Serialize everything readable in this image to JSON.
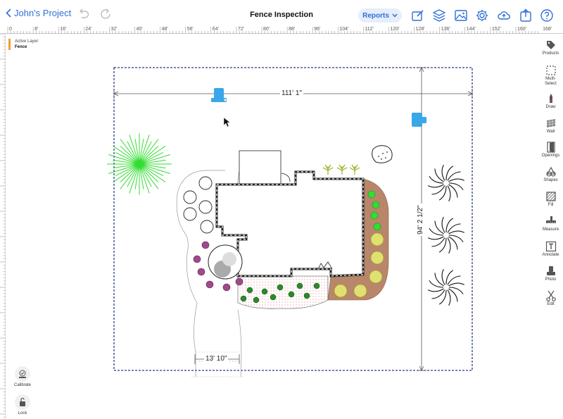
{
  "header": {
    "back_label": "John's Project",
    "title": "Fence Inspection",
    "reports_label": "Reports"
  },
  "ruler": {
    "labels": [
      "0",
      "8'",
      "16'",
      "24'",
      "32'",
      "40'",
      "48'",
      "56'",
      "64'",
      "72'",
      "80'",
      "88'",
      "96'",
      "104'",
      "112'",
      "120'",
      "128'",
      "136'",
      "144'",
      "152'",
      "160'",
      "168'"
    ]
  },
  "active_layer": {
    "label": "Active Layer:",
    "value": "Fence"
  },
  "dimensions": {
    "width": "111' 1\"",
    "height": "94' 2 1/2\"",
    "gate": "13' 10\""
  },
  "sidebar": {
    "items": [
      {
        "label": "Products",
        "icon": "tag-icon"
      },
      {
        "label": "Multi-Select",
        "icon": "multi-select-icon"
      },
      {
        "label": "Draw",
        "icon": "pencil-icon"
      },
      {
        "label": "Wall",
        "icon": "wall-icon"
      },
      {
        "label": "Openings",
        "icon": "door-icon"
      },
      {
        "label": "Shapes",
        "icon": "shapes-icon"
      },
      {
        "label": "Fill",
        "icon": "fill-icon"
      },
      {
        "label": "Measure",
        "icon": "measure-icon"
      },
      {
        "label": "Annotate",
        "icon": "text-box-icon"
      },
      {
        "label": "Photo",
        "icon": "camera-pin-icon"
      },
      {
        "label": "Edit",
        "icon": "scissors-icon"
      }
    ]
  },
  "bottom_left": {
    "calibrate_label": "Calibrate",
    "lock_label": "Lock"
  },
  "colors": {
    "accent": "#2f6fd8",
    "fence": "#2a3a8a",
    "mulch": "#b8866a",
    "grass_green": "#33dd33",
    "marker_blue": "#3aa7e8"
  }
}
